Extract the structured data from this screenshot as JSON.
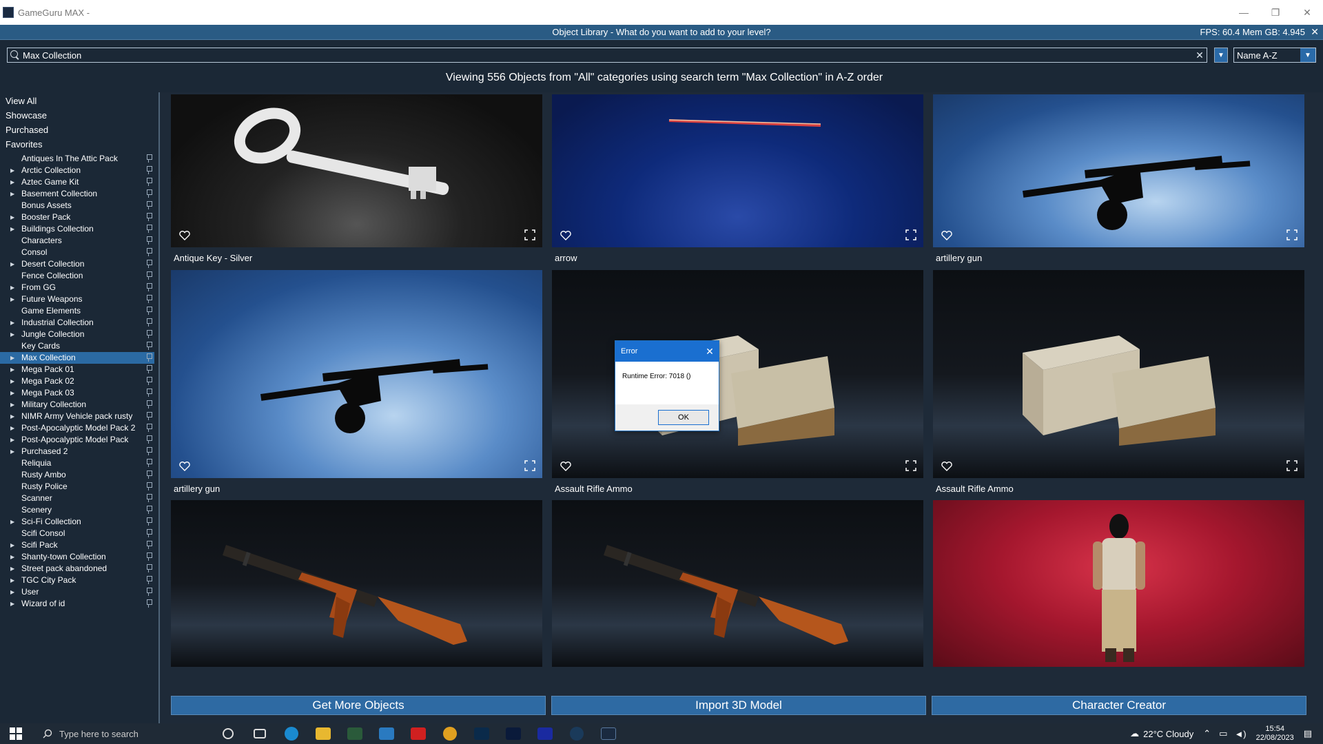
{
  "window": {
    "title": "GameGuru MAX -",
    "minimize": "—",
    "restore": "❐",
    "close": "✕"
  },
  "library": {
    "header_title": "Object Library - What do you want to add to your level?",
    "fps_text": "FPS: 60.4 Mem GB: 4.945",
    "close_icon": "✕"
  },
  "search": {
    "value": "Max Collection",
    "clear_icon": "✕",
    "filter_icon": "▼",
    "sort_label": "Name A-Z",
    "sort_arrow": "▼"
  },
  "viewing_text": "Viewing 556 Objects from \"All\" categories using search term \"Max Collection\" in A-Z order",
  "sidebar": {
    "top_items": [
      "View All",
      "Showcase",
      "Purchased",
      "Favorites"
    ],
    "items": [
      {
        "label": "Antiques In The Attic Pack",
        "expandable": false
      },
      {
        "label": "Arctic Collection",
        "expandable": true
      },
      {
        "label": "Aztec Game Kit",
        "expandable": true
      },
      {
        "label": "Basement Collection",
        "expandable": true
      },
      {
        "label": "Bonus Assets",
        "expandable": false
      },
      {
        "label": "Booster Pack",
        "expandable": true
      },
      {
        "label": "Buildings Collection",
        "expandable": true
      },
      {
        "label": "Characters",
        "expandable": false
      },
      {
        "label": "Consol",
        "expandable": false
      },
      {
        "label": "Desert Collection",
        "expandable": true
      },
      {
        "label": "Fence Collection",
        "expandable": false
      },
      {
        "label": "From GG",
        "expandable": true
      },
      {
        "label": "Future Weapons",
        "expandable": true
      },
      {
        "label": "Game Elements",
        "expandable": false
      },
      {
        "label": "Industrial Collection",
        "expandable": true
      },
      {
        "label": "Jungle Collection",
        "expandable": true
      },
      {
        "label": "Key Cards",
        "expandable": false
      },
      {
        "label": "Max Collection",
        "expandable": true,
        "active": true
      },
      {
        "label": "Mega Pack 01",
        "expandable": true
      },
      {
        "label": "Mega Pack 02",
        "expandable": true
      },
      {
        "label": "Mega Pack 03",
        "expandable": true
      },
      {
        "label": "Military Collection",
        "expandable": true
      },
      {
        "label": "NIMR Army Vehicle pack rusty",
        "expandable": true
      },
      {
        "label": "Post-Apocalyptic Model Pack 2",
        "expandable": true
      },
      {
        "label": "Post-Apocalyptic Model Pack",
        "expandable": true
      },
      {
        "label": "Purchased 2",
        "expandable": true
      },
      {
        "label": "Reliquia",
        "expandable": false
      },
      {
        "label": "Rusty Ambo",
        "expandable": false
      },
      {
        "label": "Rusty Police",
        "expandable": false
      },
      {
        "label": "Scanner",
        "expandable": false
      },
      {
        "label": "Scenery",
        "expandable": false
      },
      {
        "label": "Sci-Fi Collection",
        "expandable": true
      },
      {
        "label": "Scifi Consol",
        "expandable": false
      },
      {
        "label": "Scifi Pack",
        "expandable": true
      },
      {
        "label": "Shanty-town Collection",
        "expandable": true
      },
      {
        "label": "Street pack abandoned",
        "expandable": true
      },
      {
        "label": "TGC City Pack",
        "expandable": true
      },
      {
        "label": "User",
        "expandable": true
      },
      {
        "label": "Wizard of id",
        "expandable": true
      }
    ]
  },
  "tiles": [
    {
      "label": "Antique Key - Silver",
      "thumb": "key-thumbnail",
      "bg": "dark"
    },
    {
      "label": "arrow",
      "thumb": "arrow-thumbnail",
      "bg": "blue"
    },
    {
      "label": "artillery gun",
      "thumb": "artillery-thumbnail",
      "bg": "lightblue"
    },
    {
      "label": "artillery gun",
      "thumb": "artillery-thumbnail",
      "bg": "lightblue"
    },
    {
      "label": "Assault Rifle Ammo",
      "thumb": "ammo-box-thumbnail",
      "bg": "floor"
    },
    {
      "label": "Assault Rifle Ammo",
      "thumb": "ammo-box-thumbnail",
      "bg": "floor"
    },
    {
      "label": "",
      "thumb": "rifle-thumbnail",
      "bg": "floor"
    },
    {
      "label": "",
      "thumb": "rifle-thumbnail",
      "bg": "floor"
    },
    {
      "label": "",
      "thumb": "character-thumbnail",
      "bg": "red"
    }
  ],
  "buttons": {
    "get_more": "Get More Objects",
    "import_model": "Import 3D Model",
    "character_creator": "Character Creator"
  },
  "dialog": {
    "title": "Error",
    "message": "Runtime Error: 7018 ()",
    "ok_label": "OK",
    "close_icon": "✕"
  },
  "taskbar": {
    "search_placeholder": "Type here to search",
    "weather": "22°C Cloudy",
    "time": "15:54",
    "date": "22/08/2023"
  },
  "colors": {
    "header": "#2a5b84",
    "accent": "#2e6aa3",
    "background": "#1b2836",
    "dialog_title": "#1a6fd0"
  }
}
